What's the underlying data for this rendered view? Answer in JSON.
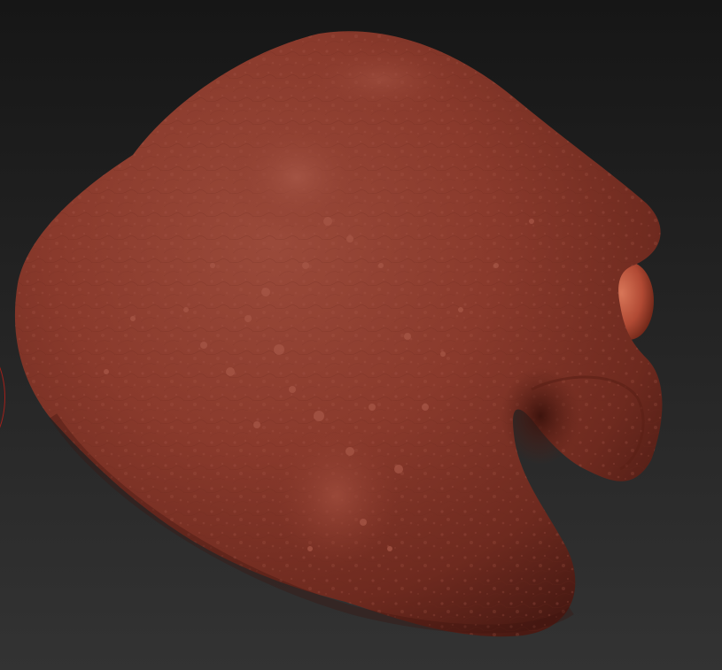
{
  "viewport": {
    "background_top": "#161616",
    "background_bottom": "#333333"
  },
  "model": {
    "subject": "sculpted-head-mesh",
    "material_color": "#8a3a2b",
    "eye_color": "#b14a34"
  },
  "brush_cursor": {
    "color": "#b0201a"
  }
}
